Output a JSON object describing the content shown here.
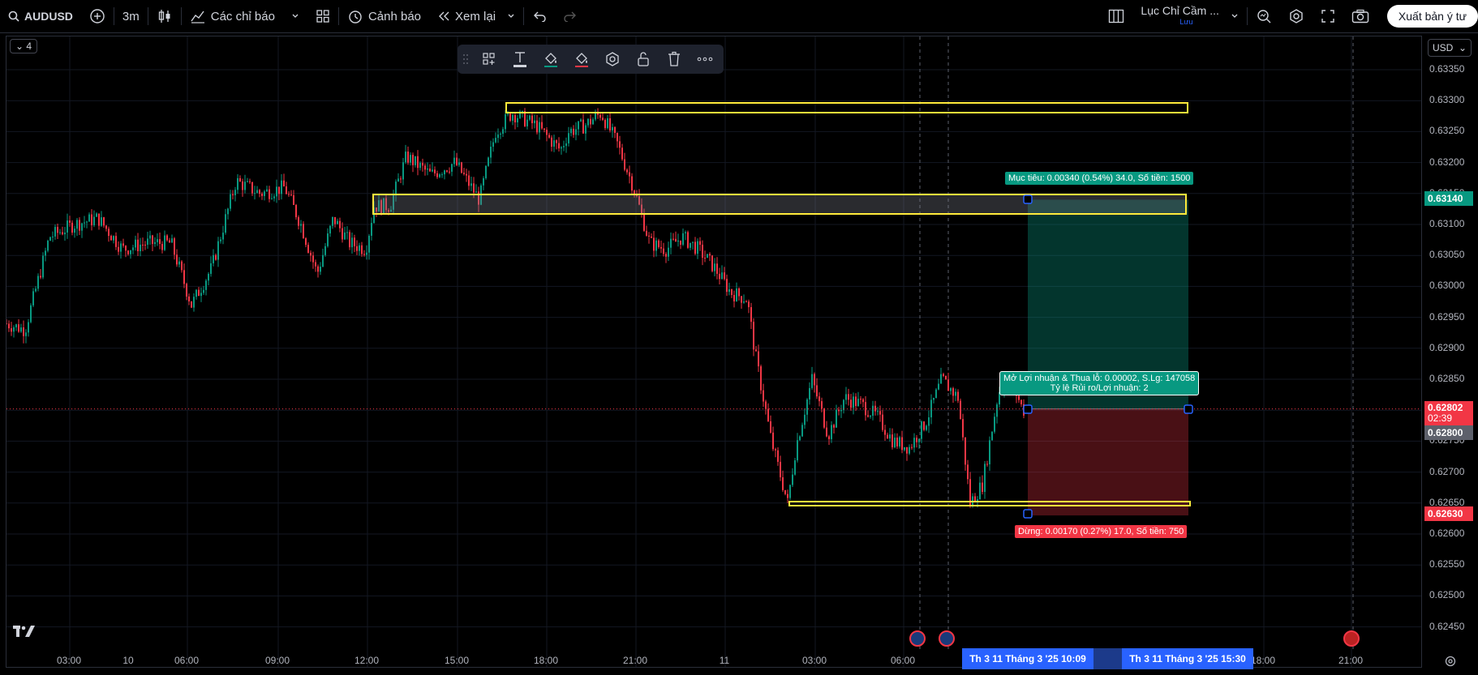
{
  "toolbar": {
    "symbol": "AUDUSD",
    "interval": "3m",
    "indicators": "Các chỉ báo",
    "alerts": "Cảnh báo",
    "replay": "Xem lại",
    "layout_name": "Lục Chỉ Cầm ...",
    "layout_status": "Lưu",
    "publish": "Xuất bản ý tư"
  },
  "chart": {
    "pane_badge": "4",
    "currency": "USD",
    "price_ticks": [
      "0.63350",
      "0.63300",
      "0.63250",
      "0.63200",
      "0.63150",
      "0.63100",
      "0.63050",
      "0.63000",
      "0.62950",
      "0.62900",
      "0.62850",
      "0.62800",
      "0.62750",
      "0.62700",
      "0.62650",
      "0.62600",
      "0.62550",
      "0.62500",
      "0.62450"
    ],
    "time_ticks": [
      "03:00",
      "10",
      "06:00",
      "09:00",
      "12:00",
      "15:00",
      "18:00",
      "21:00",
      "11",
      "03:00",
      "06:00",
      "18:00",
      "21:00"
    ],
    "tags": {
      "target_price": "0.63140",
      "current_price": "0.62802",
      "countdown": "02:39",
      "entry_price": "0.62800",
      "stop_price": "0.62630"
    },
    "labels": {
      "target": "Mục tiêu: 0.00340 (0.54%) 34.0, Số tiền: 1500",
      "open_pnl_line1": "Mở Lợi nhuận & Thua lỗ: 0.00002, S.Lg: 147058",
      "open_pnl_line2": "Tỷ lệ Rủi ro/Lợi nhuận: 2",
      "stop": "Dừng: 0.00170 (0.27%) 17.0, Số tiền: 750"
    },
    "time_tags": [
      "Th 3 11 Tháng 3 '25   10:09",
      "Th 3 11 Tháng 3 '25   15:30"
    ],
    "colors": {
      "up": "#089981",
      "down": "#f23645",
      "zone": "#ffeb3b",
      "accent": "#2962ff"
    }
  }
}
